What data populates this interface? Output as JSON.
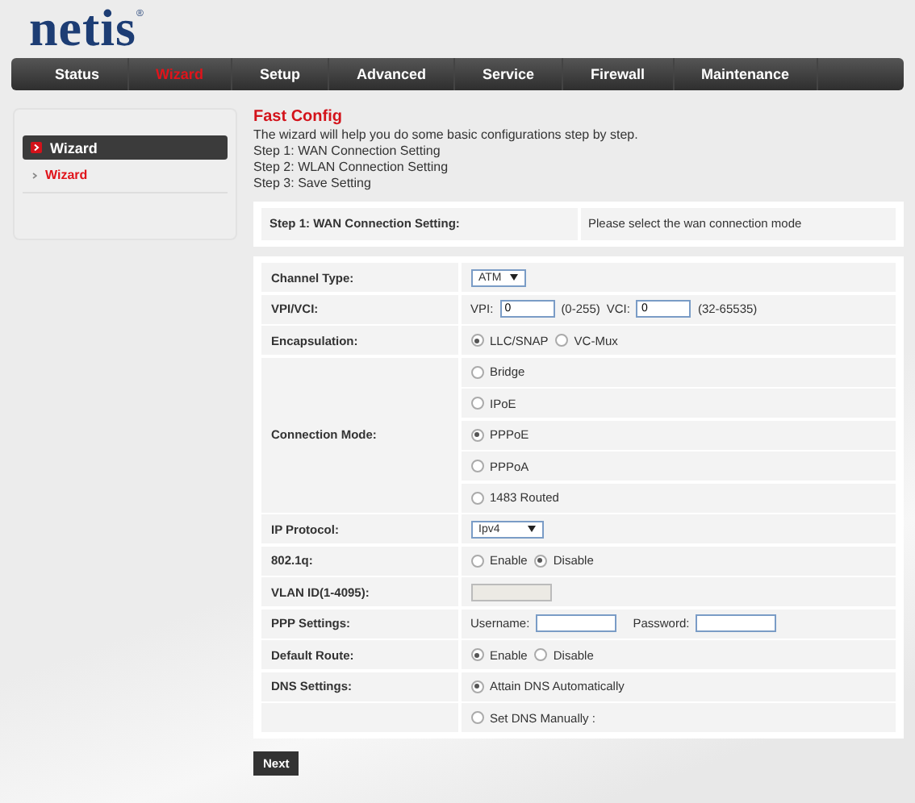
{
  "logo": {
    "text": "netis",
    "mark": "®"
  },
  "nav": [
    {
      "label": "Status",
      "selected": false
    },
    {
      "label": "Wizard",
      "selected": true
    },
    {
      "label": "Setup",
      "selected": false
    },
    {
      "label": "Advanced",
      "selected": false
    },
    {
      "label": "Service",
      "selected": false
    },
    {
      "label": "Firewall",
      "selected": false
    },
    {
      "label": "Maintenance",
      "selected": false
    }
  ],
  "sidebar": {
    "header": "Wizard",
    "items": [
      {
        "label": "Wizard",
        "selected": true
      }
    ]
  },
  "intro": {
    "title": "Fast Config",
    "lines": [
      "The wizard will help you do some basic configurations step by step.",
      "Step 1: WAN Connection Setting",
      "Step 2: WLAN Connection Setting",
      "Step 3: Save Setting"
    ]
  },
  "step": {
    "label": "Step 1: WAN Connection Setting:",
    "hint": "Please select the wan connection mode"
  },
  "fields": [
    {
      "kind": "select",
      "label": "Channel Type:",
      "value": "ATM"
    },
    {
      "kind": "pair",
      "label": "VPI/VCI:",
      "parts": [
        {
          "label": "VPI:",
          "value": "0",
          "hint": "(0-255)"
        },
        {
          "label": "VCI:",
          "value": "0",
          "hint": "(32-65535)"
        }
      ]
    },
    {
      "kind": "radio",
      "label": "Encapsulation:",
      "options": [
        {
          "label": "LLC/SNAP",
          "selected": true
        },
        {
          "label": "VC-Mux",
          "selected": false
        }
      ]
    },
    {
      "kind": "stack",
      "label": "Connection Mode:",
      "options": [
        {
          "label": "Bridge",
          "selected": false
        },
        {
          "label": "IPoE",
          "selected": false
        },
        {
          "label": "PPPoE",
          "selected": true
        },
        {
          "label": "PPPoA",
          "selected": false
        },
        {
          "label": "1483 Routed",
          "selected": false
        }
      ]
    },
    {
      "kind": "select",
      "label": "IP Protocol:",
      "value": "Ipv4"
    },
    {
      "kind": "radio",
      "label": "802.1q:",
      "options": [
        {
          "label": "Enable",
          "selected": false
        },
        {
          "label": "Disable",
          "selected": true
        }
      ]
    },
    {
      "kind": "input",
      "label": "VLAN ID(1-4095):",
      "disabled": true
    },
    {
      "kind": "inputs",
      "label": "PPP Settings:",
      "parts": [
        {
          "label": "Username:"
        },
        {
          "label": "Password:"
        }
      ]
    },
    {
      "kind": "radio",
      "label": "Default Route:",
      "options": [
        {
          "label": "Enable",
          "selected": true
        },
        {
          "label": "Disable",
          "selected": false
        }
      ]
    },
    {
      "kind": "radio",
      "label": "DNS Settings:",
      "options": [
        {
          "label": "Attain DNS Automatically",
          "selected": true
        }
      ]
    },
    {
      "kind": "radio",
      "options": [
        {
          "label": "Set DNS Manually :",
          "selected": false
        }
      ]
    }
  ],
  "next_button": "Next"
}
